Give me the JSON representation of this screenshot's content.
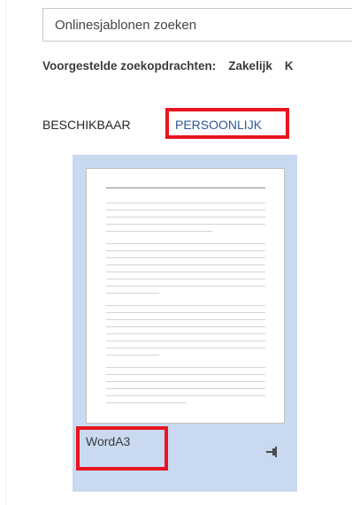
{
  "search": {
    "placeholder": "Onlinesjablonen zoeken",
    "value": ""
  },
  "suggestions": {
    "label": "Voorgestelde zoekopdrachten:",
    "items": [
      "Zakelijk",
      "K"
    ]
  },
  "tabs": [
    {
      "label": "BESCHIKBAAR",
      "selected": false
    },
    {
      "label": "PERSOONLIJK",
      "selected": true
    }
  ],
  "template": {
    "name": "WordA3",
    "pin_icon": "pin-icon"
  },
  "colors": {
    "accent": "#2b579a",
    "card_background": "#c8d9f0",
    "highlight": "#e8141f"
  }
}
